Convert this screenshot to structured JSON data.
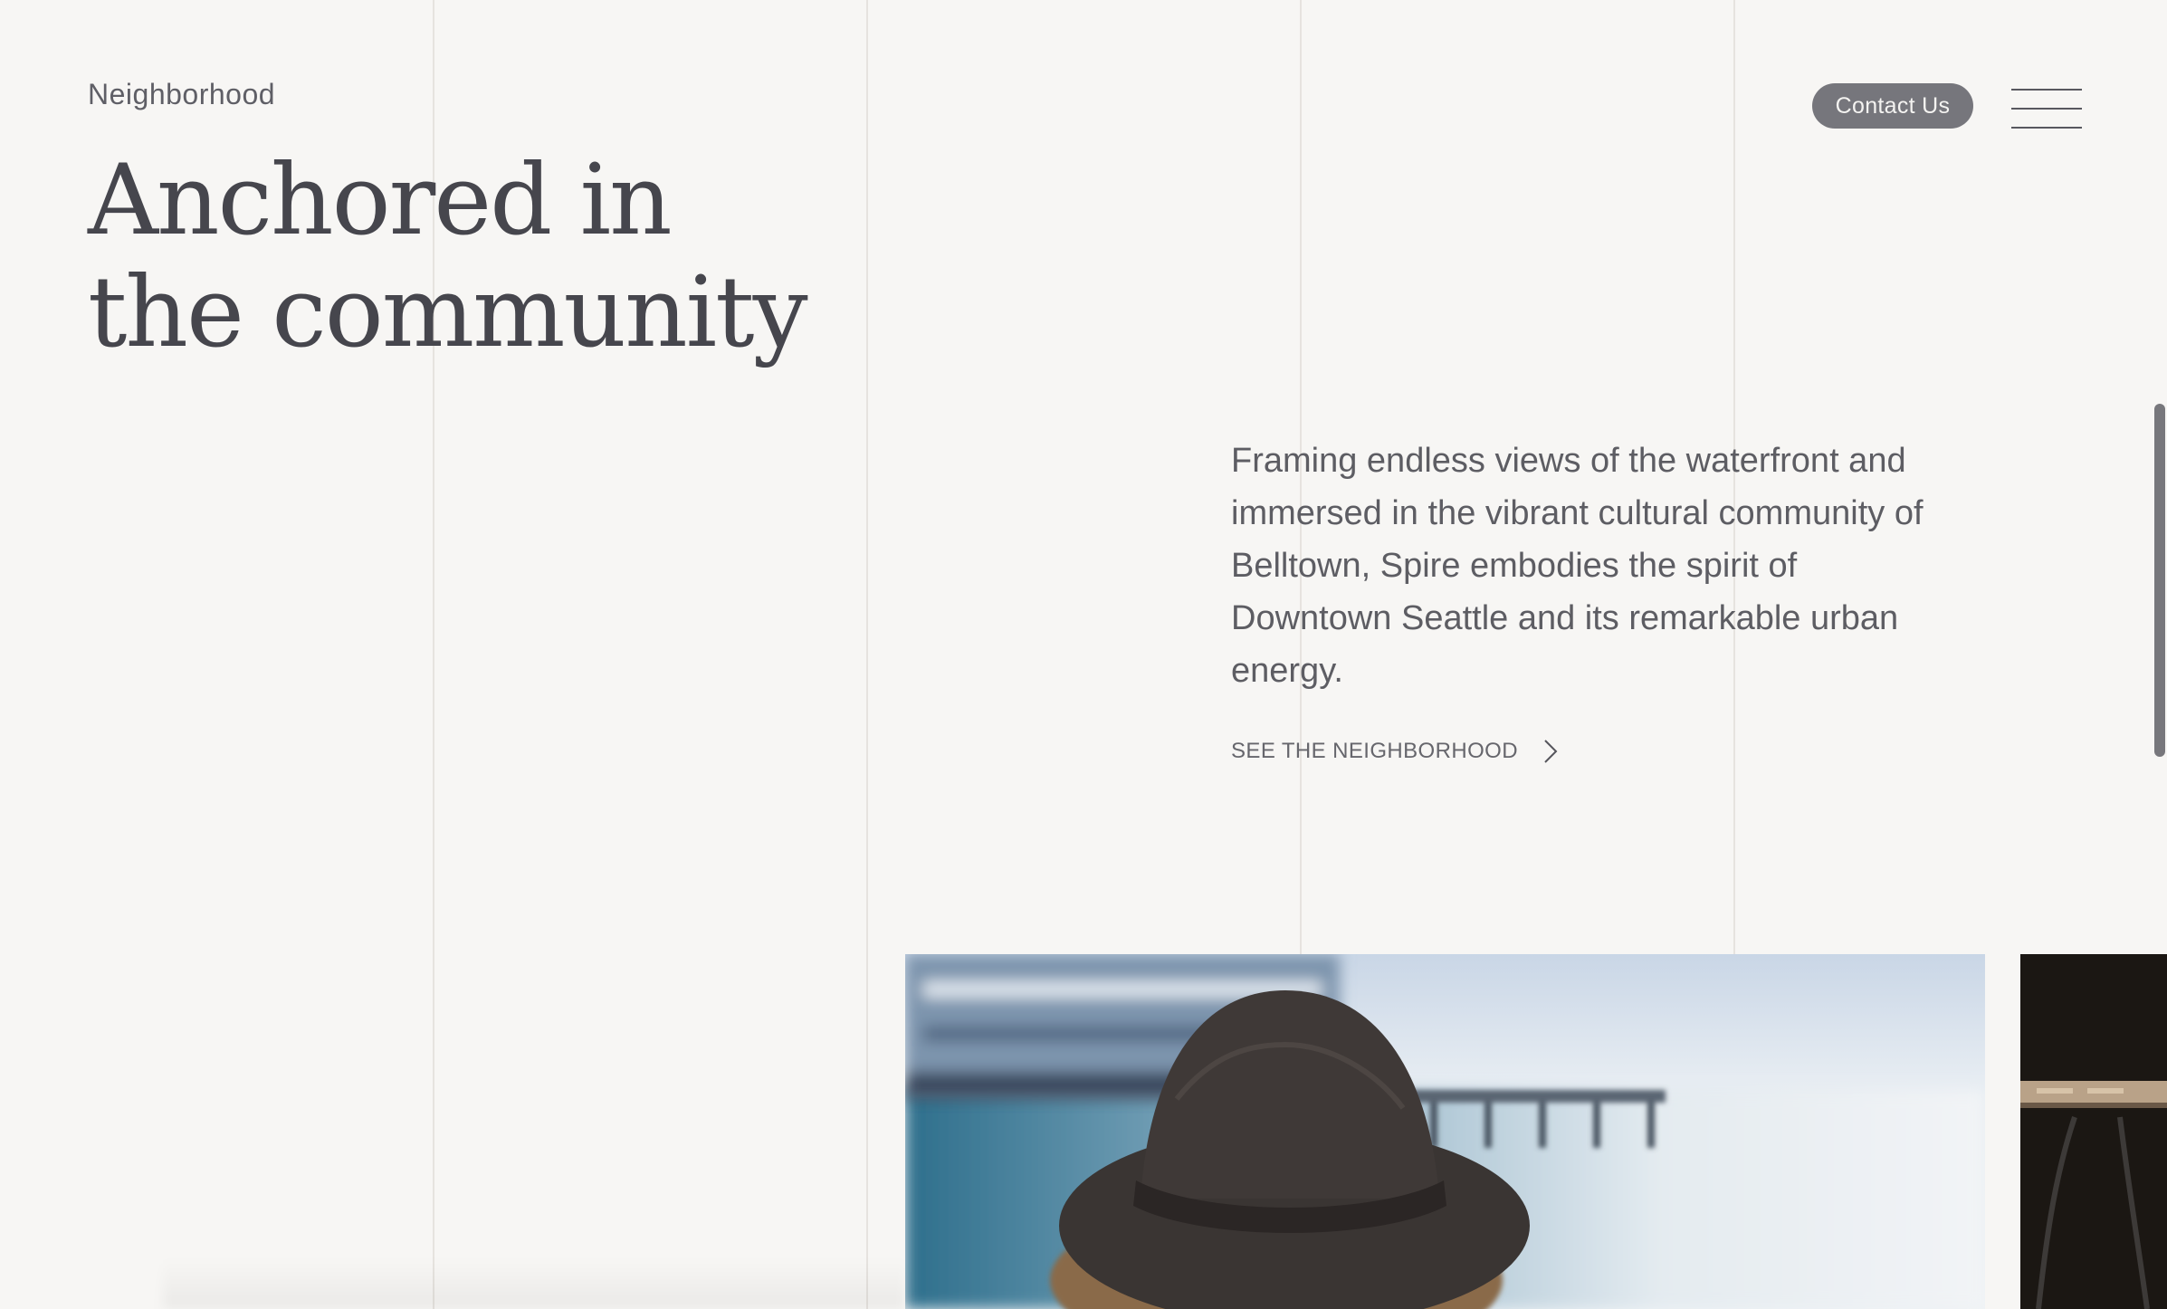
{
  "header": {
    "section_label": "Neighborhood",
    "contact_label": "Contact Us",
    "menu_icon": "hamburger-menu-icon"
  },
  "hero": {
    "title_line_1": "Anchored in",
    "title_line_2": "the community"
  },
  "intro": {
    "body": "Framing endless views of the waterfront and immersed in the vibrant cultural community of Belltown, Spire embodies the spirit of Downtown Seattle and its remarkable urban energy.",
    "cta_label": "SEE THE NEIGHBORHOOD",
    "cta_icon": "chevron-right-icon"
  },
  "gallery": {
    "items": [
      "person-in-hat-at-waterfront-photo",
      "outdoor-dining-photo"
    ]
  },
  "colors": {
    "background": "#f7f6f4",
    "text": "#46464d",
    "button": "#76767c",
    "gridline": "#e6e3df"
  }
}
